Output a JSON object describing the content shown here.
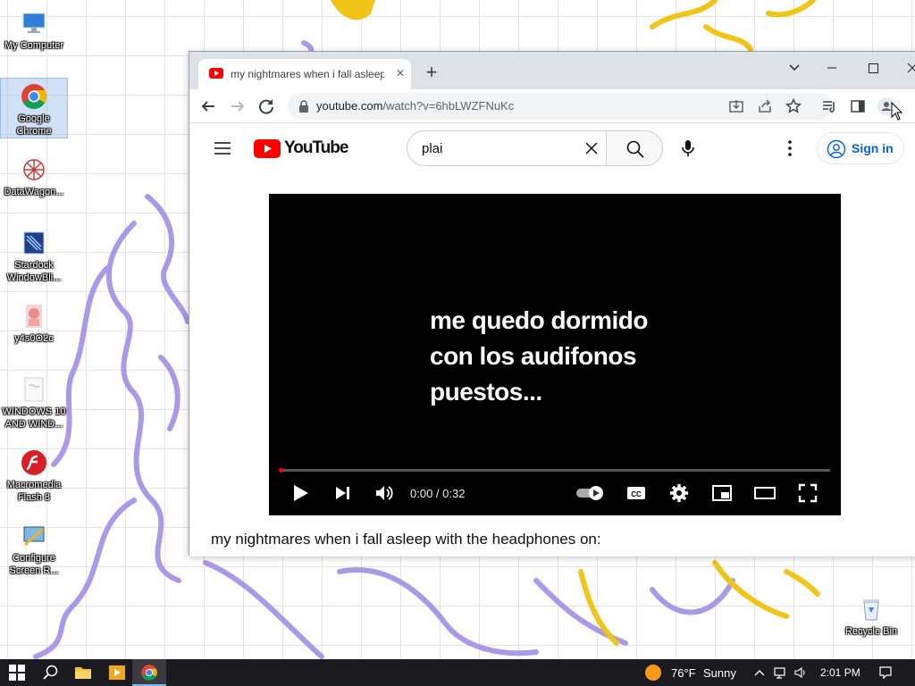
{
  "desktop": {
    "icons": [
      {
        "label": "My Computer",
        "icon": "computer-icon"
      },
      {
        "label": "Google Chrome",
        "icon": "chrome-icon"
      },
      {
        "label": "DataWagon...",
        "icon": "datawagon-icon"
      },
      {
        "label": "Stardock WindowBli...",
        "icon": "windowblinds-icon"
      },
      {
        "label": "y4s0O2c",
        "icon": "image-file-icon"
      },
      {
        "label": "WINDOWS 10 AND WIND...",
        "icon": "image-file-icon"
      },
      {
        "label": "Macromedia Flash 8",
        "icon": "flash-icon"
      },
      {
        "label": "Configure Screen R...",
        "icon": "configure-screen-icon"
      }
    ],
    "recycle_bin": {
      "label": "Recycle Bin",
      "icon": "recycle-bin-icon"
    }
  },
  "browser": {
    "tab_title": "my nightmares when i fall asleep with the headphones on: - YouTube",
    "tab_close": "✕",
    "new_tab": "+",
    "url_host": "youtube.com",
    "url_path": "/watch?v=6hbLWZFNuKc"
  },
  "youtube": {
    "logo_text": "YouTube",
    "search_value": "plai",
    "sign_in": "Sign in",
    "player": {
      "caption": "me quedo dormido\ncon los audifonos\npuestos...",
      "timecode": "0:00 / 0:32",
      "progress": 0.0
    },
    "video_title": "my nightmares when i fall asleep with the headphones on:"
  },
  "taskbar": {
    "weather_temp": "76°F",
    "weather_condition": "Sunny",
    "time": "2:01 PM"
  },
  "colors": {
    "youtube_red": "#ff0000",
    "link_blue": "#065fd4",
    "taskbar": "#1b1b1f",
    "wallpaper_purple": "#9d8be0",
    "wallpaper_yellow": "#f0c419"
  }
}
